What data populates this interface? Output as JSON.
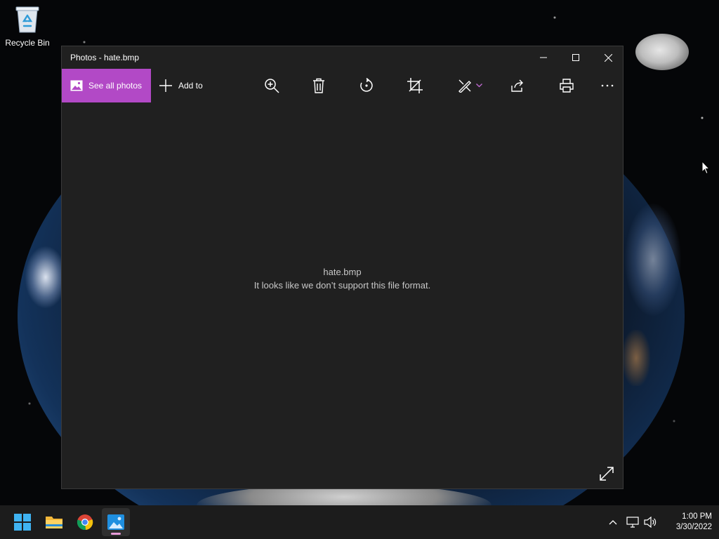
{
  "desktop": {
    "icons": [
      {
        "label": "Recycle Bin",
        "icon": "recycle-bin-icon"
      }
    ]
  },
  "window": {
    "title": "Photos - hate.bmp",
    "controls": [
      "minimize-icon",
      "maximize-icon",
      "close-icon"
    ],
    "toolbar": {
      "see_all_label": "See all photos",
      "add_to_label": "Add to",
      "icons": [
        "zoom-in-icon",
        "delete-icon",
        "rotate-icon",
        "crop-icon",
        "edit-icon",
        "share-icon",
        "print-icon",
        "more-icon"
      ]
    },
    "message": {
      "filename": "hate.bmp",
      "text": "It looks like we don’t support this file format."
    }
  },
  "taskbar": {
    "apps": [
      "start-icon",
      "file-explorer-icon",
      "chrome-icon",
      "photos-icon"
    ],
    "active_app": "photos-icon",
    "tray": [
      "chevron-up-icon",
      "network-icon",
      "volume-icon"
    ],
    "time": "1:00 PM",
    "date": "3/30/2022"
  },
  "colors": {
    "accent": "#b249c6",
    "window_bg": "#202020",
    "taskbar_bg": "#1c1c1c"
  }
}
